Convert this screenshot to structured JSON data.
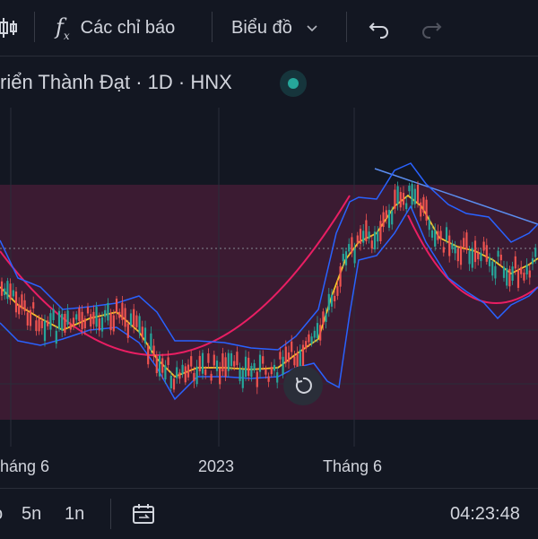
{
  "toolbar": {
    "indicators_label": "Các chỉ báo",
    "chart_type_label": "Biểu đồ"
  },
  "symbol": {
    "title": "riển Thành Đạt · 1D · HNX",
    "market_status_color": "#26a69a"
  },
  "time_axis": {
    "ticks": [
      "háng 6",
      "2023",
      "Tháng 6"
    ]
  },
  "bottom_bar": {
    "ranges": [
      "5n",
      "1n"
    ],
    "clock": "04:23:48"
  },
  "colors": {
    "background": "#131722",
    "bullish": "#26a69a",
    "bearish": "#ef5350",
    "bollinger": "#2962ff",
    "moving_average": "#f7c52b",
    "highlight_zone": "#5d1f40",
    "arc": "#e91e63"
  },
  "icons": [
    "candles-icon",
    "function-icon",
    "chevron-down-icon",
    "undo-icon",
    "redo-icon",
    "reset-icon",
    "date-range-icon"
  ]
}
